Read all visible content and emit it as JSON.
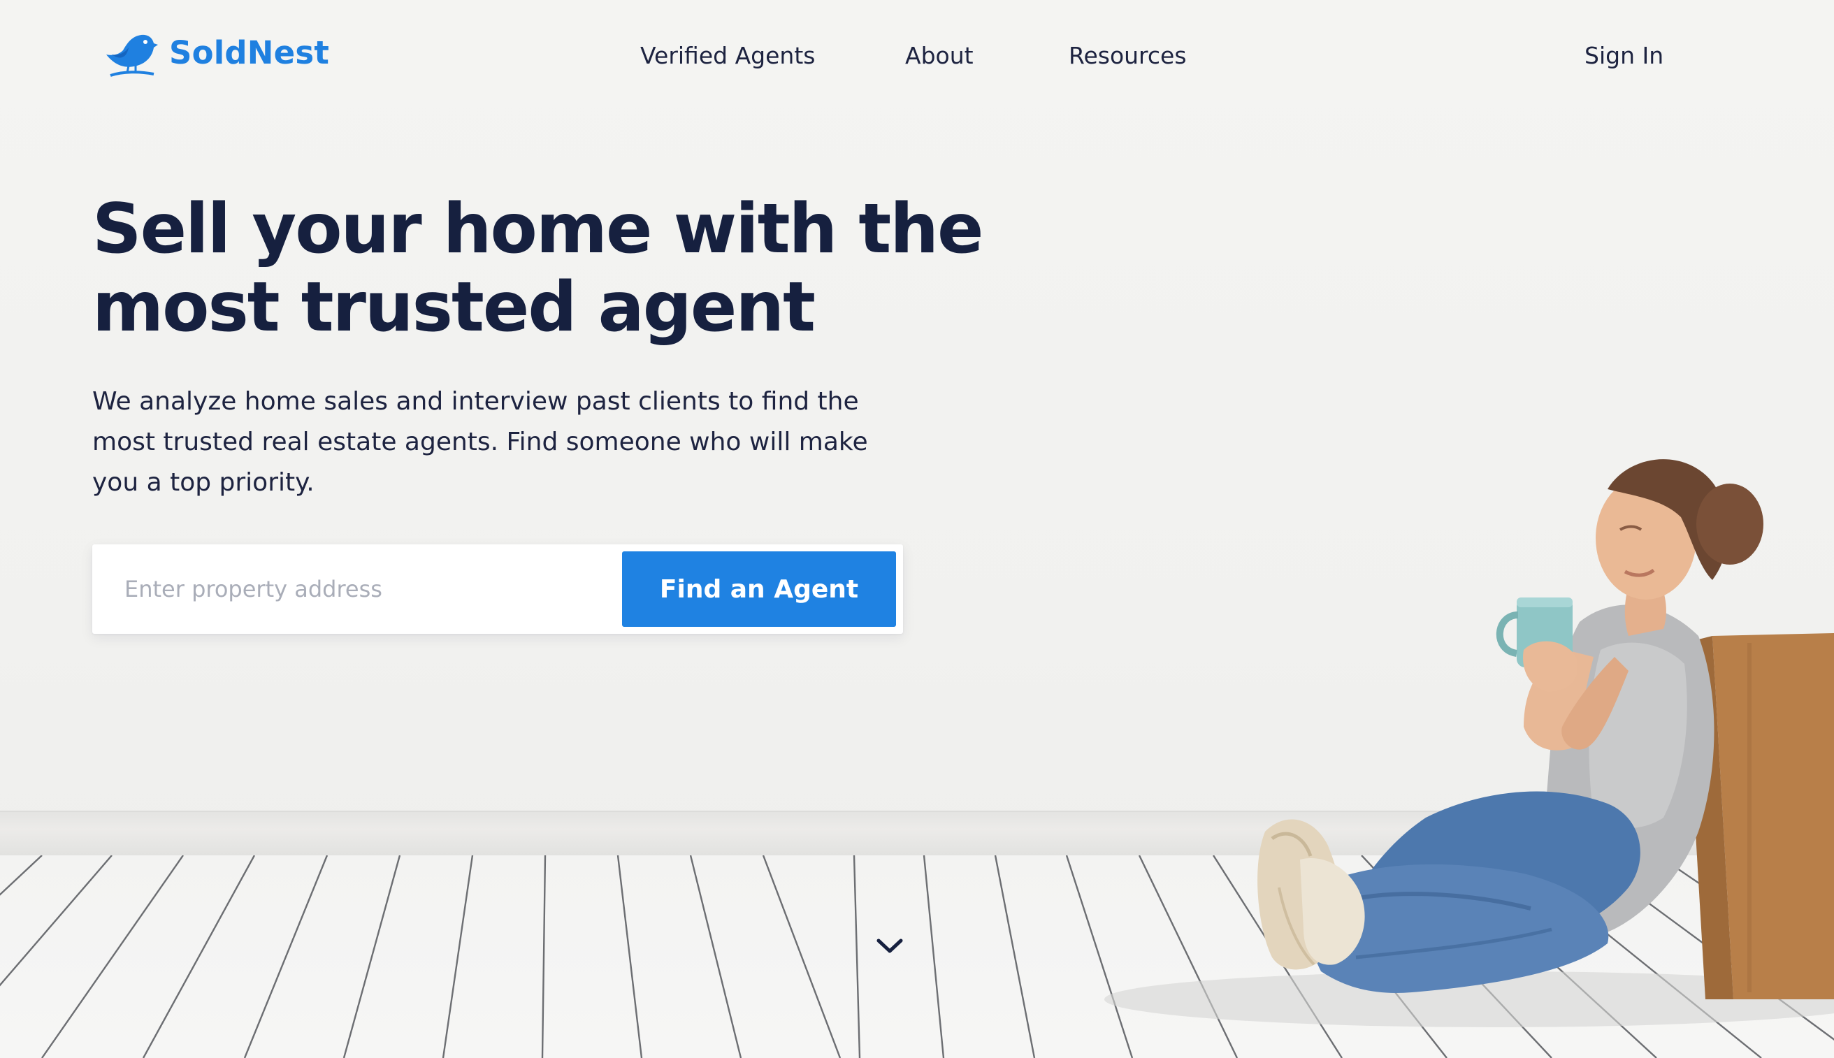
{
  "brand": {
    "name": "SoldNest",
    "logo_icon": "bird-icon",
    "color": "#1f80e0"
  },
  "nav": {
    "items": [
      {
        "label": "Verified Agents"
      },
      {
        "label": "About"
      },
      {
        "label": "Resources"
      }
    ],
    "sign_in": "Sign In"
  },
  "hero": {
    "headline_lines": [
      "Sell your home with the",
      "most trusted agent"
    ],
    "subtext_lines": [
      "We analyze home sales and interview past clients to find the",
      "most trusted real estate agents. Find someone who will make",
      "you a top priority."
    ],
    "search": {
      "placeholder": "Enter property address",
      "value": "",
      "button_label": "Find an Agent"
    },
    "scroll_icon": "chevron-down-icon"
  },
  "colors": {
    "accent": "#1f82e2",
    "text_dark": "#16203f",
    "background": "#f3f3f1"
  }
}
